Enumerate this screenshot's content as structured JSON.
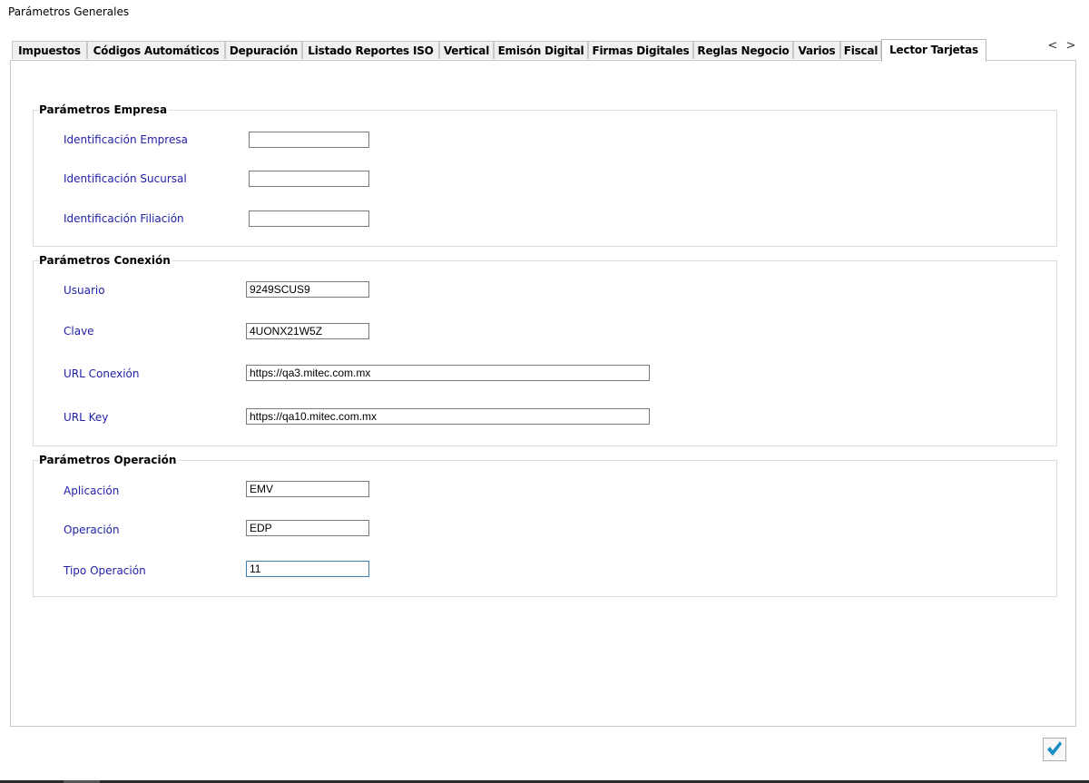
{
  "window": {
    "title": "Parámetros Generales"
  },
  "tabs": [
    {
      "label": "Impuestos",
      "active": false
    },
    {
      "label": "Códigos Automáticos",
      "active": false
    },
    {
      "label": "Depuración",
      "active": false
    },
    {
      "label": "Listado Reportes ISO",
      "active": false
    },
    {
      "label": "Vertical",
      "active": false
    },
    {
      "label": "Emisón Digital",
      "active": false
    },
    {
      "label": "Firmas Digitales",
      "active": false
    },
    {
      "label": "Reglas Negocio",
      "active": false
    },
    {
      "label": "Varios",
      "active": false
    },
    {
      "label": "Fiscal",
      "active": false
    },
    {
      "label": "Lector Tarjetas",
      "active": true
    }
  ],
  "tab_scroll": {
    "left": "<",
    "right": ">"
  },
  "groups": {
    "empresa": {
      "title": "Parámetros Empresa",
      "fields": [
        {
          "label": "Identificación Empresa",
          "value": ""
        },
        {
          "label": "Identificación Sucursal",
          "value": ""
        },
        {
          "label": "Identificación Filiación",
          "value": ""
        }
      ]
    },
    "conexion": {
      "title": "Parámetros Conexión",
      "fields": [
        {
          "label": "Usuario",
          "value": "9249SCUS9"
        },
        {
          "label": "Clave",
          "value": "4UONX21W5Z"
        },
        {
          "label": "URL Conexión",
          "value": "https://qa3.mitec.com.mx"
        },
        {
          "label": "URL Key",
          "value": "https://qa10.mitec.com.mx"
        }
      ]
    },
    "operacion": {
      "title": "Parámetros Operación",
      "fields": [
        {
          "label": "Aplicación",
          "value": "EMV"
        },
        {
          "label": "Operación",
          "value": "EDP"
        },
        {
          "label": "Tipo Operación",
          "value": "11"
        }
      ]
    }
  },
  "colors": {
    "label": "#1f1fa8",
    "accept_check": "#1a8fc4",
    "focus_border": "#3c7fb1"
  },
  "icons": {
    "accept": "check-icon"
  }
}
